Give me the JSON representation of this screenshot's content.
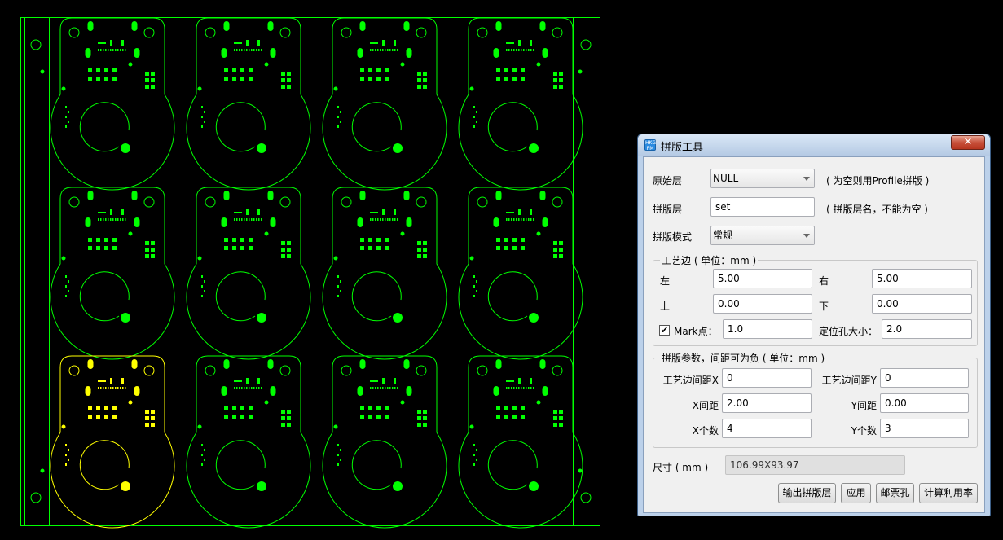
{
  "colors": {
    "board_outline": "#00ff00",
    "board_selected": "#ffff00",
    "background": "#000000"
  },
  "canvas": {
    "grid_cols": 4,
    "grid_rows": 3,
    "selected_board": [
      0,
      2
    ]
  },
  "dialog": {
    "icon_text": "HKG PM",
    "title": "拼版工具",
    "close_symbol": "✕",
    "source_layer": {
      "label": "原始层",
      "value": "NULL",
      "hint": "( 为空则用Profile拼版 )"
    },
    "panel_layer": {
      "label": "拼版层",
      "value": "set",
      "hint": "( 拼版层名，不能为空 )"
    },
    "panel_mode": {
      "label": "拼版模式",
      "value": "常规"
    },
    "process_edge": {
      "title": "工艺边 ( 单位：mm )",
      "left_label": "左",
      "left_value": "5.00",
      "right_label": "右",
      "right_value": "5.00",
      "top_label": "上",
      "top_value": "0.00",
      "bottom_label": "下",
      "bottom_value": "0.00",
      "mark_checked": "✔",
      "mark_label": "Mark点：",
      "mark_value": "1.0",
      "hole_label": "定位孔大小：",
      "hole_value": "2.0"
    },
    "panel_params": {
      "title": "拼版参数，间距可为负 ( 单位：mm )",
      "edge_gap_x_label": "工艺边间距X",
      "edge_gap_x_value": "0",
      "edge_gap_y_label": "工艺边间距Y",
      "edge_gap_y_value": "0",
      "x_gap_label": "X间距",
      "x_gap_value": "2.00",
      "y_gap_label": "Y间距",
      "y_gap_value": "0.00",
      "x_count_label": "X个数",
      "x_count_value": "4",
      "y_count_label": "Y个数",
      "y_count_value": "3"
    },
    "size": {
      "label": "尺寸 ( mm )",
      "value": "106.99X93.97"
    },
    "buttons": {
      "output": "输出拼版层",
      "apply": "应用",
      "stamp_hole": "邮票孔",
      "utilization": "计算利用率"
    }
  }
}
